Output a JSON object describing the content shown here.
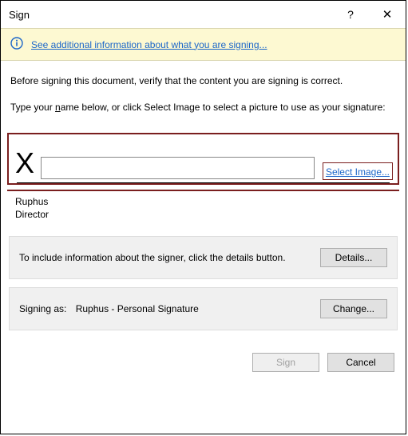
{
  "window": {
    "title": "Sign",
    "help_tooltip": "?",
    "close_tooltip": "✕"
  },
  "banner": {
    "link_text": "See additional information about what you are signing..."
  },
  "verify_text": "Before signing this document, verify that the content you are signing is correct.",
  "name_instruction_prefix": "Type your ",
  "name_instruction_key": "n",
  "name_instruction_suffix": "ame below, or click Select Image to select a picture to use as your signature:",
  "signature": {
    "x_label": "X",
    "input_value": "",
    "select_image_label": "Select Image..."
  },
  "signer": {
    "name": "Ruphus",
    "title": "Director"
  },
  "details": {
    "text": "To include information about the signer, click the details button.",
    "button": "Details..."
  },
  "change": {
    "label": "Signing as:",
    "value": "Ruphus - Personal Signature",
    "button": "Change..."
  },
  "footer": {
    "sign": "Sign",
    "cancel": "Cancel"
  }
}
